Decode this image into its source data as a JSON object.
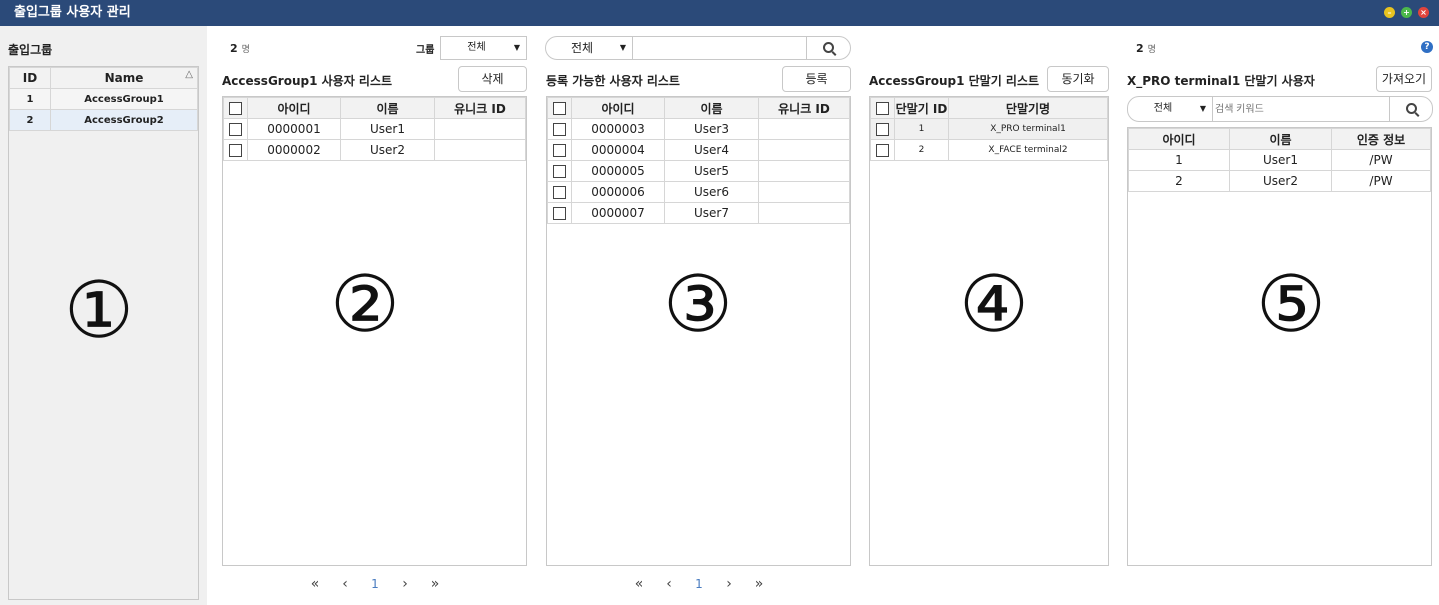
{
  "title": "출입그룹 사용자 관리",
  "panel1": {
    "title": "출입그룹",
    "headers": [
      "ID",
      "Name"
    ],
    "rows": [
      [
        "1",
        "AccessGroup1"
      ],
      [
        "2",
        "AccessGroup2"
      ]
    ],
    "marker": "①"
  },
  "panel2": {
    "count": "2",
    "count_unit": "명",
    "group_label": "그룹",
    "group_value": "전체",
    "title": "AccessGroup1 사용자 리스트",
    "delete_label": "삭제",
    "headers": [
      "아이디",
      "이름",
      "유니크 ID"
    ],
    "rows": [
      [
        "0000001",
        "User1",
        ""
      ],
      [
        "0000002",
        "User2",
        ""
      ]
    ],
    "page": "1",
    "marker": "②"
  },
  "panel3": {
    "filter_value": "전체",
    "search_value": "",
    "title": "등록 가능한 사용자 리스트",
    "register_label": "등록",
    "headers": [
      "아이디",
      "이름",
      "유니크 ID"
    ],
    "rows": [
      [
        "0000003",
        "User3",
        ""
      ],
      [
        "0000004",
        "User4",
        ""
      ],
      [
        "0000005",
        "User5",
        ""
      ],
      [
        "0000006",
        "User6",
        ""
      ],
      [
        "0000007",
        "User7",
        ""
      ]
    ],
    "page": "1",
    "marker": "③"
  },
  "panel4": {
    "title": "AccessGroup1 단말기 리스트",
    "sync_label": "동기화",
    "headers": [
      "단말기 ID",
      "단말기명"
    ],
    "rows": [
      [
        "1",
        "X_PRO terminal1"
      ],
      [
        "2",
        "X_FACE terminal2"
      ]
    ],
    "marker": "④"
  },
  "panel5": {
    "count": "2",
    "count_unit": "명",
    "title": "X_PRO terminal1 단말기 사용자",
    "import_label": "가져오기",
    "filter_value": "전체",
    "search_placeholder": "검색 키워드",
    "headers": [
      "아이디",
      "이름",
      "인증 정보"
    ],
    "rows": [
      [
        "1",
        "User1",
        "/PW"
      ],
      [
        "2",
        "User2",
        "/PW"
      ]
    ],
    "marker": "⑤"
  },
  "pager_glyphs": {
    "first": "«",
    "prev": "‹",
    "next": "›",
    "last": "»"
  },
  "colors": {
    "titlebar": "#2b4a79",
    "selected_row": "#e6eef8",
    "page_link": "#4a7cc0"
  }
}
